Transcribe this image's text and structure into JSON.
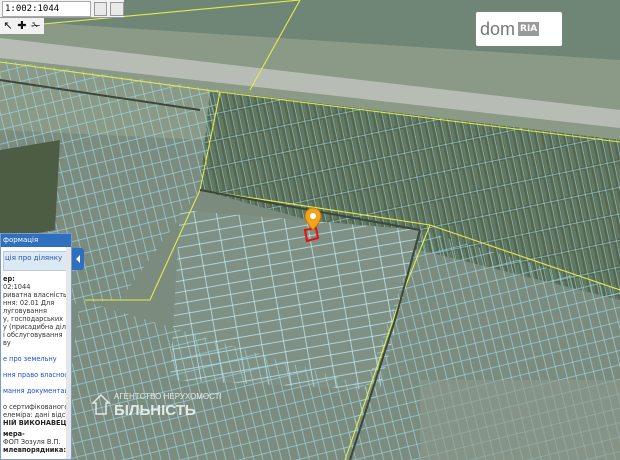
{
  "toolbar": {
    "cadastral_number": "1:002:1044"
  },
  "tools": {
    "pointer_glyph": "↖",
    "identify_glyph": "✚",
    "measure_glyph": "✁"
  },
  "panel": {
    "title": "формація",
    "section": "ція про ділянку",
    "lines": [
      "ер:",
      "02:1044",
      "риватна власність",
      "ння: 02.01 Для",
      "луговування",
      "у, господарських",
      "у (присадибна ділянка)",
      "і обслуговування",
      "ву"
    ],
    "link1": "е про земельну",
    "link2": "ння право власності та",
    "link3": "мання документації із",
    "lines2": [
      "о сертифікованого",
      "елеміра: дані відсутні",
      "НІЙ ВИКОНАВЕЦЬ",
      "мера-",
      "ФОП Зозуля В.П.",
      "млевпорядника:"
    ]
  },
  "logo": {
    "dom": "dom",
    "ria": "RIA"
  },
  "watermark": {
    "line1": "АГЕНТСТВО НЕРУХОМОСТІ",
    "line2": "БІЛЬНІСТЬ"
  },
  "colors": {
    "parcel_line": "#8fd6e6",
    "boundary_line": "#e3ec4a",
    "marker": "#f3a21b",
    "selected_parcel": "#e01010"
  }
}
